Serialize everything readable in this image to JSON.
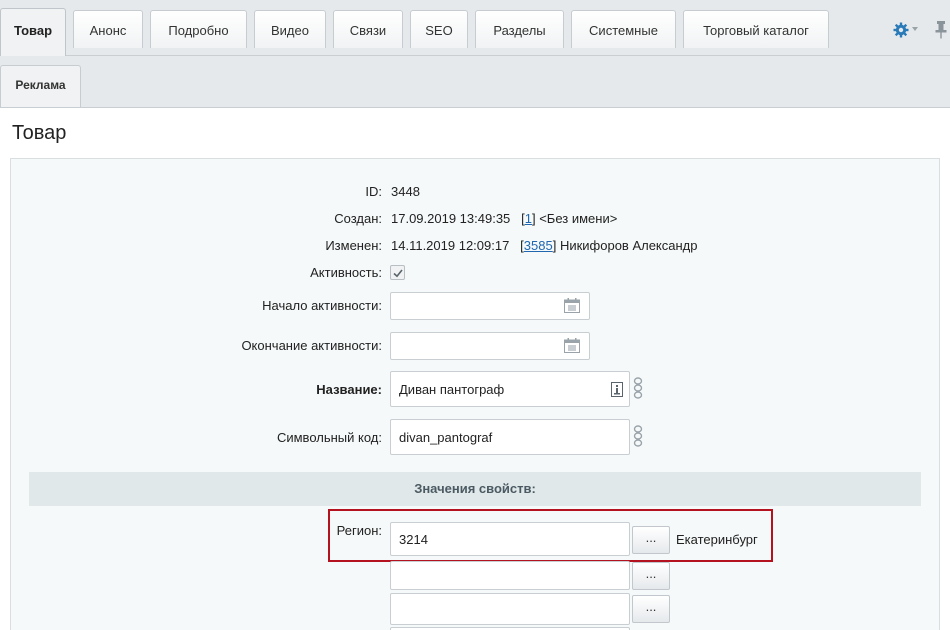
{
  "tabs_row1": [
    {
      "label": "Товар",
      "active": true
    },
    {
      "label": "Анонс"
    },
    {
      "label": "Подробно"
    },
    {
      "label": "Видео"
    },
    {
      "label": "Связи"
    },
    {
      "label": "SEO"
    },
    {
      "label": "Разделы"
    },
    {
      "label": "Системные"
    },
    {
      "label": "Торговый каталог"
    }
  ],
  "tabs_row2": [
    {
      "label": "Реклама"
    }
  ],
  "page_title": "Товар",
  "fields": {
    "id_label": "ID:",
    "id_value": "3448",
    "created_label": "Создан:",
    "created_date": "17.09.2019 13:49:35",
    "created_user_id": "1",
    "created_user_name": "<Без имени>",
    "modified_label": "Изменен:",
    "modified_date": "14.11.2019 12:09:17",
    "modified_user_id": "3585",
    "modified_user_name": "Никифоров Александр",
    "active_label": "Активность:",
    "active_start_label": "Начало активности:",
    "active_start_value": "",
    "active_end_label": "Окончание активности:",
    "active_end_value": "",
    "name_label": "Название:",
    "name_value": "Диван пантограф",
    "code_label": "Символьный код:",
    "code_value": "divan_pantograf"
  },
  "properties": {
    "section_title": "Значения свойств:",
    "region_label": "Регион:",
    "region_values": [
      "3214",
      "",
      ""
    ],
    "region_name": "Екатеринбург",
    "picker_label": "..."
  },
  "icons": {
    "settings": "gear-icon",
    "pin": "pin-icon",
    "calendar": "calendar-icon",
    "transliterate": "transliteration-icon",
    "visual": "visual-editor-icon"
  },
  "colors": {
    "accent": "#2067b0",
    "highlight_border": "#b3121e",
    "tabbar_bg": "#e6e9ec",
    "panel_bg": "#f5f9f9",
    "section_bg": "#e0e8ea"
  }
}
